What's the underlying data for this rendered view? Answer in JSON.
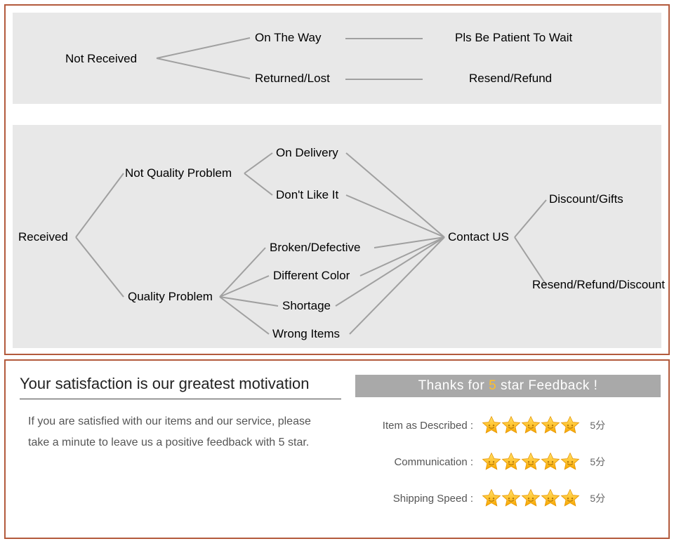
{
  "diagram": {
    "not_received": "Not Received",
    "on_the_way": "On The Way",
    "returned_lost": "Returned/Lost",
    "pls_patient": "Pls Be Patient To Wait",
    "resend_refund": "Resend/Refund",
    "received": "Received",
    "not_quality": "Not Quality Problem",
    "quality": "Quality Problem",
    "on_delivery": "On Delivery",
    "dont_like": "Don't Like It",
    "broken": "Broken/Defective",
    "diff_color": "Different Color",
    "shortage": "Shortage",
    "wrong_items": "Wrong Items",
    "contact_us": "Contact US",
    "discount_gifts": "Discount/Gifts",
    "resend_refund_discount": "Resend/Refund/Discount"
  },
  "feedback": {
    "title": "Your satisfaction is our greatest motivation",
    "body": "If you are satisfied with our items and our service, please take a minute to leave us a positive feedback with 5 star.",
    "thanks_prefix": "Thanks for ",
    "thanks_num": "5",
    "thanks_suffix": " star Feedback !",
    "rows": [
      {
        "label": "Item as Described :",
        "suffix": "5分"
      },
      {
        "label": "Communication :",
        "suffix": "5分"
      },
      {
        "label": "Shipping Speed :",
        "suffix": "5分"
      }
    ]
  }
}
